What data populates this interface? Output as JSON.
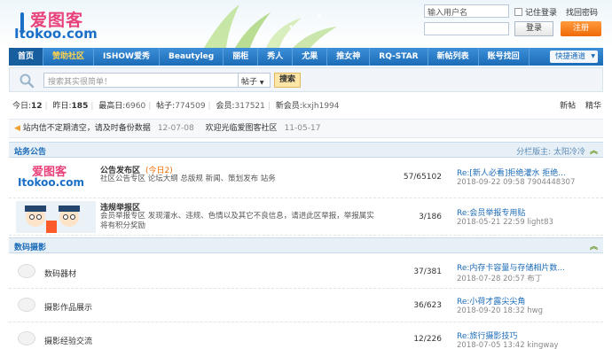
{
  "header": {
    "logo_cn": "爱图客",
    "logo_en": "Itokoo.com",
    "username_placeholder": "输入用户名",
    "remember_label": "记住登录",
    "find_password": "找回密码",
    "login_button": "登录",
    "register_button": "注册"
  },
  "nav": {
    "items": [
      "首页",
      "赞助社区",
      "ISHOW爱秀",
      "Beautyleg",
      "丽柜",
      "秀人",
      "尤果",
      "推女神",
      "RQ-STAR",
      "新帖列表",
      "账号找回"
    ],
    "quick": "快捷通道"
  },
  "search": {
    "placeholder": "搜索其实很简单！",
    "select_value": "帖子",
    "button": "搜索"
  },
  "stats": {
    "today_label": "今日:",
    "today": "12",
    "yesterday_label": "昨日:",
    "yesterday": "185",
    "max_label": "最高日:",
    "max": "6960",
    "posts_label": "帖子:",
    "posts": "774509",
    "members_label": "会员:",
    "members": "317521",
    "newest_label": "新会员:",
    "newest": "kxjh1994",
    "right_links": [
      "新帖",
      "精华"
    ]
  },
  "notices": [
    {
      "text": "站内信不定期清空，请及时备份数据",
      "date": "12-07-08"
    },
    {
      "text": "欢迎光临爱图客社区",
      "date": "11-05-17"
    }
  ],
  "sections": [
    {
      "title": "站务公告",
      "moderators_label": "分栏版主:",
      "moderator": "太阳冷冷",
      "forums": [
        {
          "name": "公告发布区",
          "today": "(今日2)",
          "desc": "社区公告专区 论坛大纲 总版规 新闻、策划发布 站务",
          "count": "57/65102",
          "last_title": "Re:[新人必看]拒绝灌水 拒绝...",
          "last_meta": "2018-09-22 09:58 7904448307"
        },
        {
          "name": "违规举报区",
          "today": "",
          "desc": "会员举报专区 发现灌水、违规、色情以及其它不良信息，请进此区举报，举报属实将有积分奖励",
          "count": "3/186",
          "last_title": "Re:会员举报专用贴",
          "last_meta": "2018-05-21 22:59 light83"
        }
      ]
    },
    {
      "title": "数码摄影",
      "forums": [
        {
          "name": "数码器材",
          "count": "37/381",
          "last_title": "Re:内存卡容量与存储相片数...",
          "last_meta": "2018-07-28 20:57 布丁"
        },
        {
          "name": "摄影作品展示",
          "count": "36/623",
          "last_title": "Re:小荷才露尖尖角",
          "last_meta": "2018-09-20 18:32 hwg"
        },
        {
          "name": "摄影经验交流",
          "count": "12/226",
          "last_title": "Re:旅行摄影技巧",
          "last_meta": "2018-07-05 13:42 kingway"
        }
      ]
    }
  ],
  "colors": {
    "brand_blue": "#1c6cb8",
    "logo_pink": "#e8417a",
    "register_orange": "#f06a06",
    "highlight": "#ffd34d"
  }
}
